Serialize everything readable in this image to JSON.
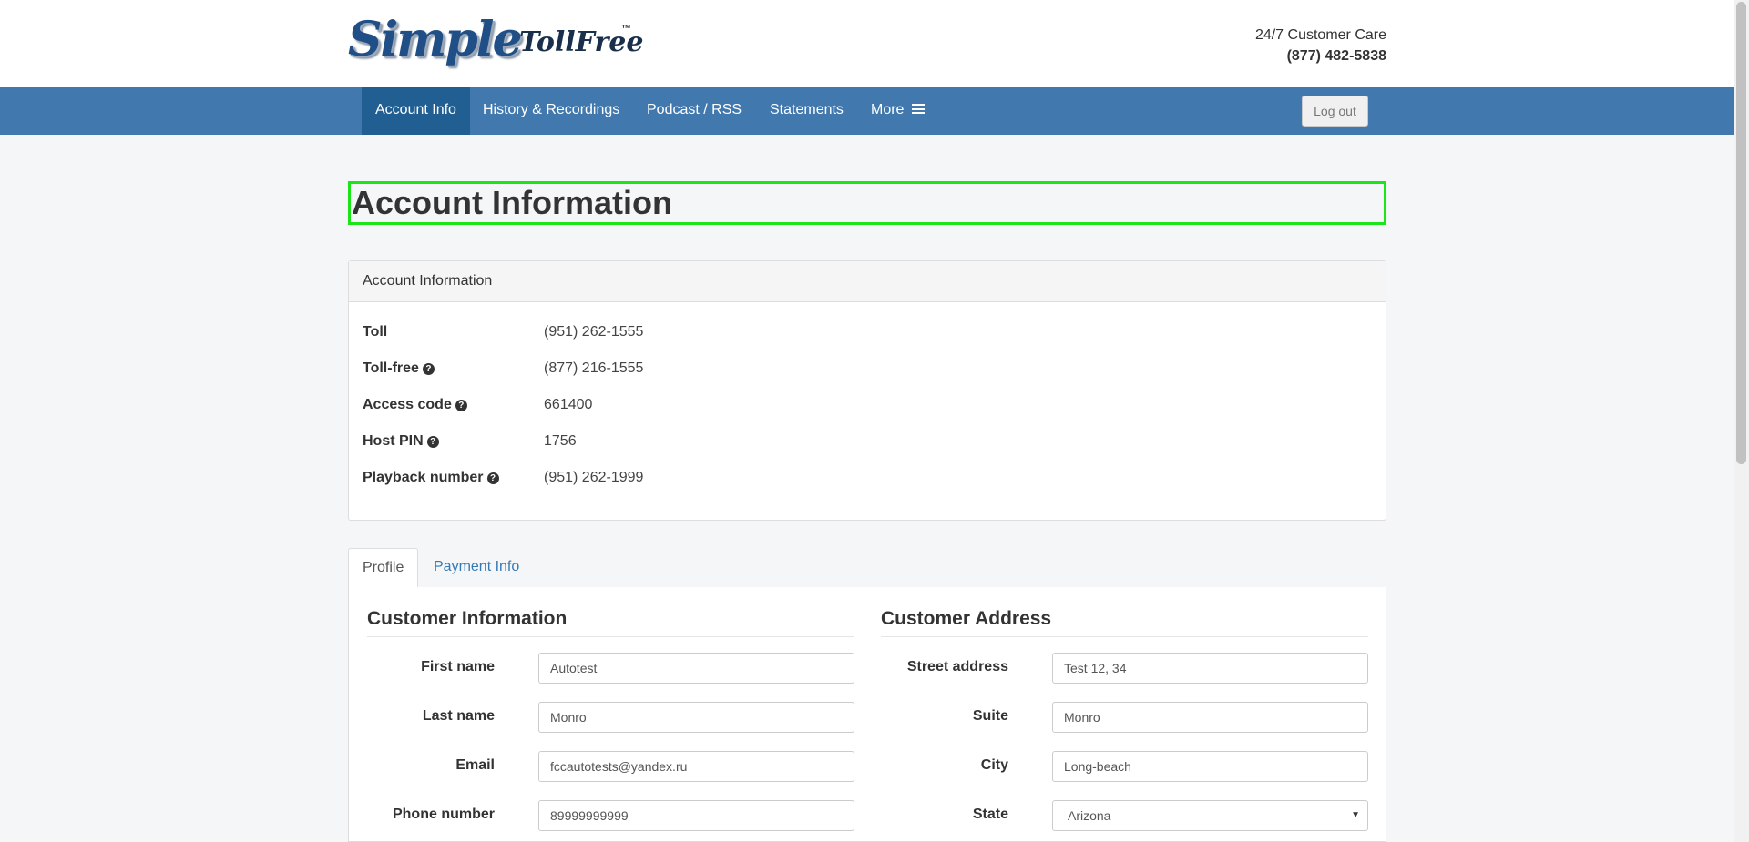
{
  "brand": {
    "name_simple": "Simple",
    "name_tollfree": "TollFree",
    "trademark": "™"
  },
  "care": {
    "label": "24/7 Customer Care",
    "phone": "(877) 482-5838"
  },
  "nav": {
    "items": [
      {
        "label": "Account Info",
        "active": true
      },
      {
        "label": "History & Recordings"
      },
      {
        "label": "Podcast / RSS"
      },
      {
        "label": "Statements"
      },
      {
        "label": "More"
      }
    ],
    "logout": "Log out"
  },
  "page_title": "Account Information",
  "account_panel": {
    "heading": "Account Information",
    "rows": [
      {
        "label": "Toll",
        "value": "(951) 262-1555",
        "help": false
      },
      {
        "label": "Toll-free",
        "value": "(877) 216-1555",
        "help": true
      },
      {
        "label": "Access code",
        "value": "661400",
        "help": true
      },
      {
        "label": "Host PIN",
        "value": "1756",
        "help": true
      },
      {
        "label": "Playback number",
        "value": "(951) 262-1999",
        "help": true
      }
    ]
  },
  "tabs": [
    {
      "label": "Profile",
      "active": true
    },
    {
      "label": "Payment Info"
    }
  ],
  "customer_info": {
    "title": "Customer Information",
    "fields": [
      {
        "label": "First name",
        "value": "Autotest"
      },
      {
        "label": "Last name",
        "value": "Monro"
      },
      {
        "label": "Email",
        "value": "fccautotests@yandex.ru"
      },
      {
        "label": "Phone number",
        "value": "89999999999"
      }
    ]
  },
  "customer_address": {
    "title": "Customer Address",
    "fields": [
      {
        "label": "Street address",
        "value": "Test 12, 34"
      },
      {
        "label": "Suite",
        "value": "Monro"
      },
      {
        "label": "City",
        "value": "Long-beach"
      },
      {
        "label": "State",
        "value": "Arizona"
      }
    ]
  },
  "icons": {
    "help": "question-circle-icon",
    "menu": "hamburger-icon",
    "dropdown": "caret-down-icon"
  },
  "colors": {
    "navbar": "#4178ae",
    "nav_active": "#215f92",
    "link": "#337ab7",
    "highlight": "#19e519"
  }
}
